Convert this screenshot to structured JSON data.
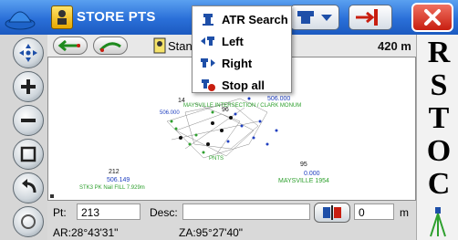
{
  "title": {
    "app_title": "STORE PTS"
  },
  "dropdown": {
    "items": [
      {
        "label": "ATR Search",
        "icon": "target-search-icon"
      },
      {
        "label": "Left",
        "icon": "rotate-left-icon"
      },
      {
        "label": "Right",
        "icon": "rotate-right-icon"
      },
      {
        "label": "Stop all",
        "icon": "stop-icon"
      }
    ]
  },
  "toolbar": {
    "status": "Standby",
    "distance": "420 m"
  },
  "right_strip": {
    "letters": [
      "R",
      "S",
      "T",
      "O",
      "C"
    ]
  },
  "map": {
    "labels": {
      "pt_506": "506.000",
      "maysville_monument": "MAYSVILLE INTERSECTION / CLARK MONUM",
      "num_14": "14",
      "num_96": "96",
      "num_212": "212",
      "val_506149": "506.149",
      "stk3": "STK3 PK Nail FILL 7.929m",
      "num_95": "95",
      "val_0": "0.000",
      "maysville_1954": "MAYSVILLE 1954",
      "pnts": "PNTS",
      "val_506000b": "506.000"
    }
  },
  "bottom": {
    "pt_label": "Pt:",
    "pt_value": "213",
    "desc_label": "Desc:",
    "desc_value": "",
    "hr_value": "0",
    "hr_unit": "m",
    "ar": "AR:28°43'31\"",
    "za": "ZA:95°27'40\""
  },
  "colors": {
    "titlebar": "#2a6fd8",
    "close": "#c81e10",
    "map_green": "#2ea02e",
    "map_blue": "#2040c0"
  }
}
